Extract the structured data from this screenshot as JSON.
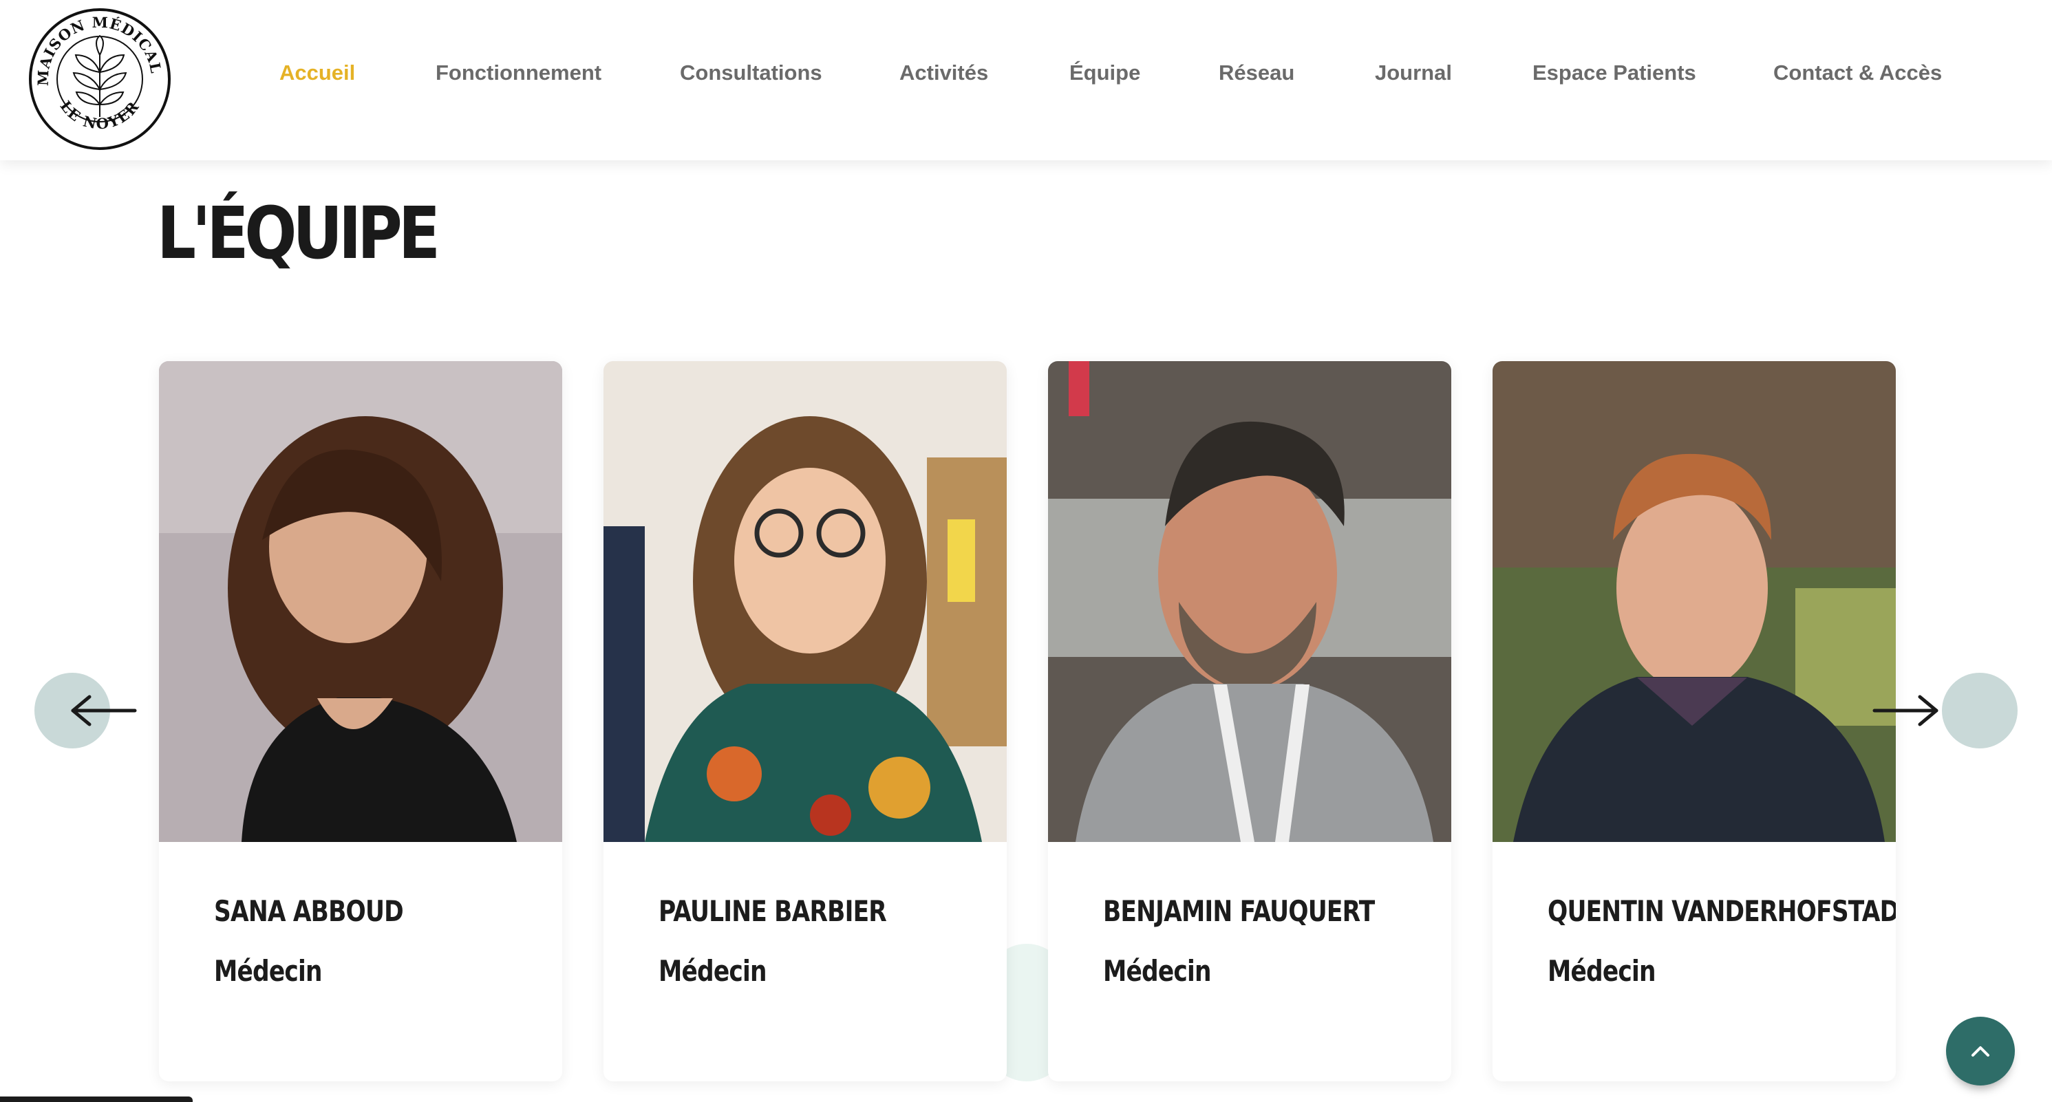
{
  "site": {
    "logo_text_top": "MAISON MÉDICALE",
    "logo_text_bottom": "LE NOYER"
  },
  "nav": {
    "items": [
      {
        "label": "Accueil",
        "active": true
      },
      {
        "label": "Fonctionnement",
        "active": false
      },
      {
        "label": "Consultations",
        "active": false
      },
      {
        "label": "Activités",
        "active": false
      },
      {
        "label": "Équipe",
        "active": false
      },
      {
        "label": "Réseau",
        "active": false
      },
      {
        "label": "Journal",
        "active": false
      },
      {
        "label": "Espace Patients",
        "active": false
      },
      {
        "label": "Contact & Accès",
        "active": false
      }
    ]
  },
  "page": {
    "title": "L'ÉQUIPE"
  },
  "team": {
    "members": [
      {
        "name": "SANA ABBOUD",
        "role": "Médecin"
      },
      {
        "name": "PAULINE BARBIER",
        "role": "Médecin"
      },
      {
        "name": "BENJAMIN FAUQUERT",
        "role": "Médecin"
      },
      {
        "name": "QUENTIN VANDERHOFSTADT",
        "role": "Médecin"
      }
    ]
  },
  "controls": {
    "prev_icon": "arrow-left-icon",
    "next_icon": "arrow-right-icon",
    "scroll_top_icon": "chevron-up-icon"
  },
  "colors": {
    "accent": "#e5b226",
    "nav_text": "#6a6a6a",
    "arrow_bg": "#c9d9d8",
    "scroll_top_bg": "#2e6d68"
  }
}
